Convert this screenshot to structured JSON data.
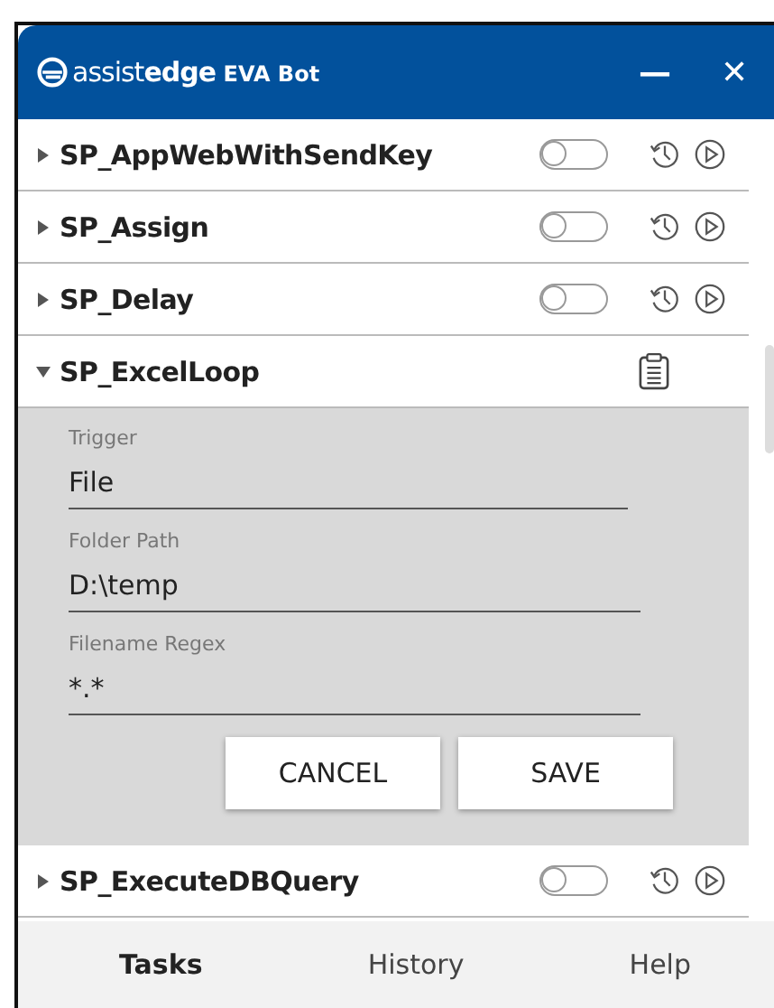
{
  "window": {
    "brand_light": "assist",
    "brand_bold": "edge",
    "title": "EVA Bot",
    "minimize": "—",
    "close": "✕"
  },
  "tasks": [
    {
      "name": "SP_AppWebWithSendKey",
      "expanded": false,
      "on": false
    },
    {
      "name": "SP_Assign",
      "expanded": false,
      "on": false
    },
    {
      "name": "SP_Delay",
      "expanded": false,
      "on": false
    },
    {
      "name": "SP_ExcelLoop",
      "expanded": true,
      "fields": [
        {
          "label": "Trigger",
          "value": "File"
        },
        {
          "label": "Folder Path",
          "value": "D:\\temp"
        },
        {
          "label": "Filename Regex",
          "value": "*.*"
        }
      ],
      "buttons": [
        "CANCEL",
        "SAVE"
      ]
    },
    {
      "name": "SP_ExecuteDBQuery",
      "expanded": false,
      "on": false
    }
  ],
  "tabs": [
    {
      "label": "Tasks",
      "selected": true
    },
    {
      "label": "History",
      "selected": false
    },
    {
      "label": "Help",
      "selected": false
    }
  ]
}
